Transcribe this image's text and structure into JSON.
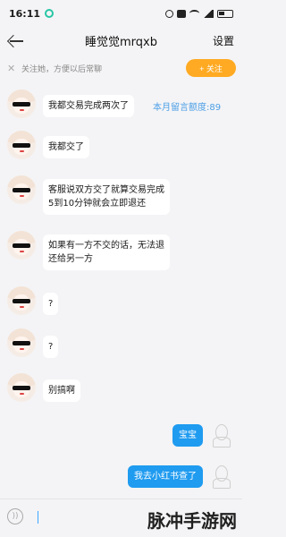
{
  "status_bar": {
    "time": "16:11",
    "icons": [
      "app-status-icon",
      "alarm-icon",
      "mute-icon",
      "wifi-icon",
      "signal-icon",
      "battery-icon"
    ]
  },
  "header": {
    "title": "睡觉觉mrqxb",
    "settings_label": "设置"
  },
  "follow_bar": {
    "close_glyph": "✕",
    "text": "关注她，方便以后常聊",
    "button_label": "+ 关注",
    "button_color": "#ffaa22"
  },
  "quota": {
    "text": "本月留言额度:89",
    "color": "#4d9fe6"
  },
  "messages": [
    {
      "sender": "other",
      "text": "我都交易完成两次了"
    },
    {
      "sender": "other",
      "text": "我都交了"
    },
    {
      "sender": "other",
      "lines": [
        "客服说双方交了就算交易完成",
        "5到10分钟就会立即退还"
      ]
    },
    {
      "sender": "other",
      "lines": [
        "如果有一方不交的话，无法退",
        "还给另一方"
      ]
    },
    {
      "sender": "other",
      "text": "?"
    },
    {
      "sender": "other",
      "text": "?"
    },
    {
      "sender": "other",
      "text": "别搞啊"
    },
    {
      "sender": "self",
      "text": "宝宝"
    },
    {
      "sender": "self",
      "text": "我去小红书查了"
    }
  ],
  "input": {
    "placeholder": "",
    "voice_icon": "voice-icon"
  },
  "colors": {
    "outgoing_bubble": "#1f9bf0",
    "background": "#f4f4f6"
  },
  "watermark": {
    "text": "脉冲手游网"
  }
}
